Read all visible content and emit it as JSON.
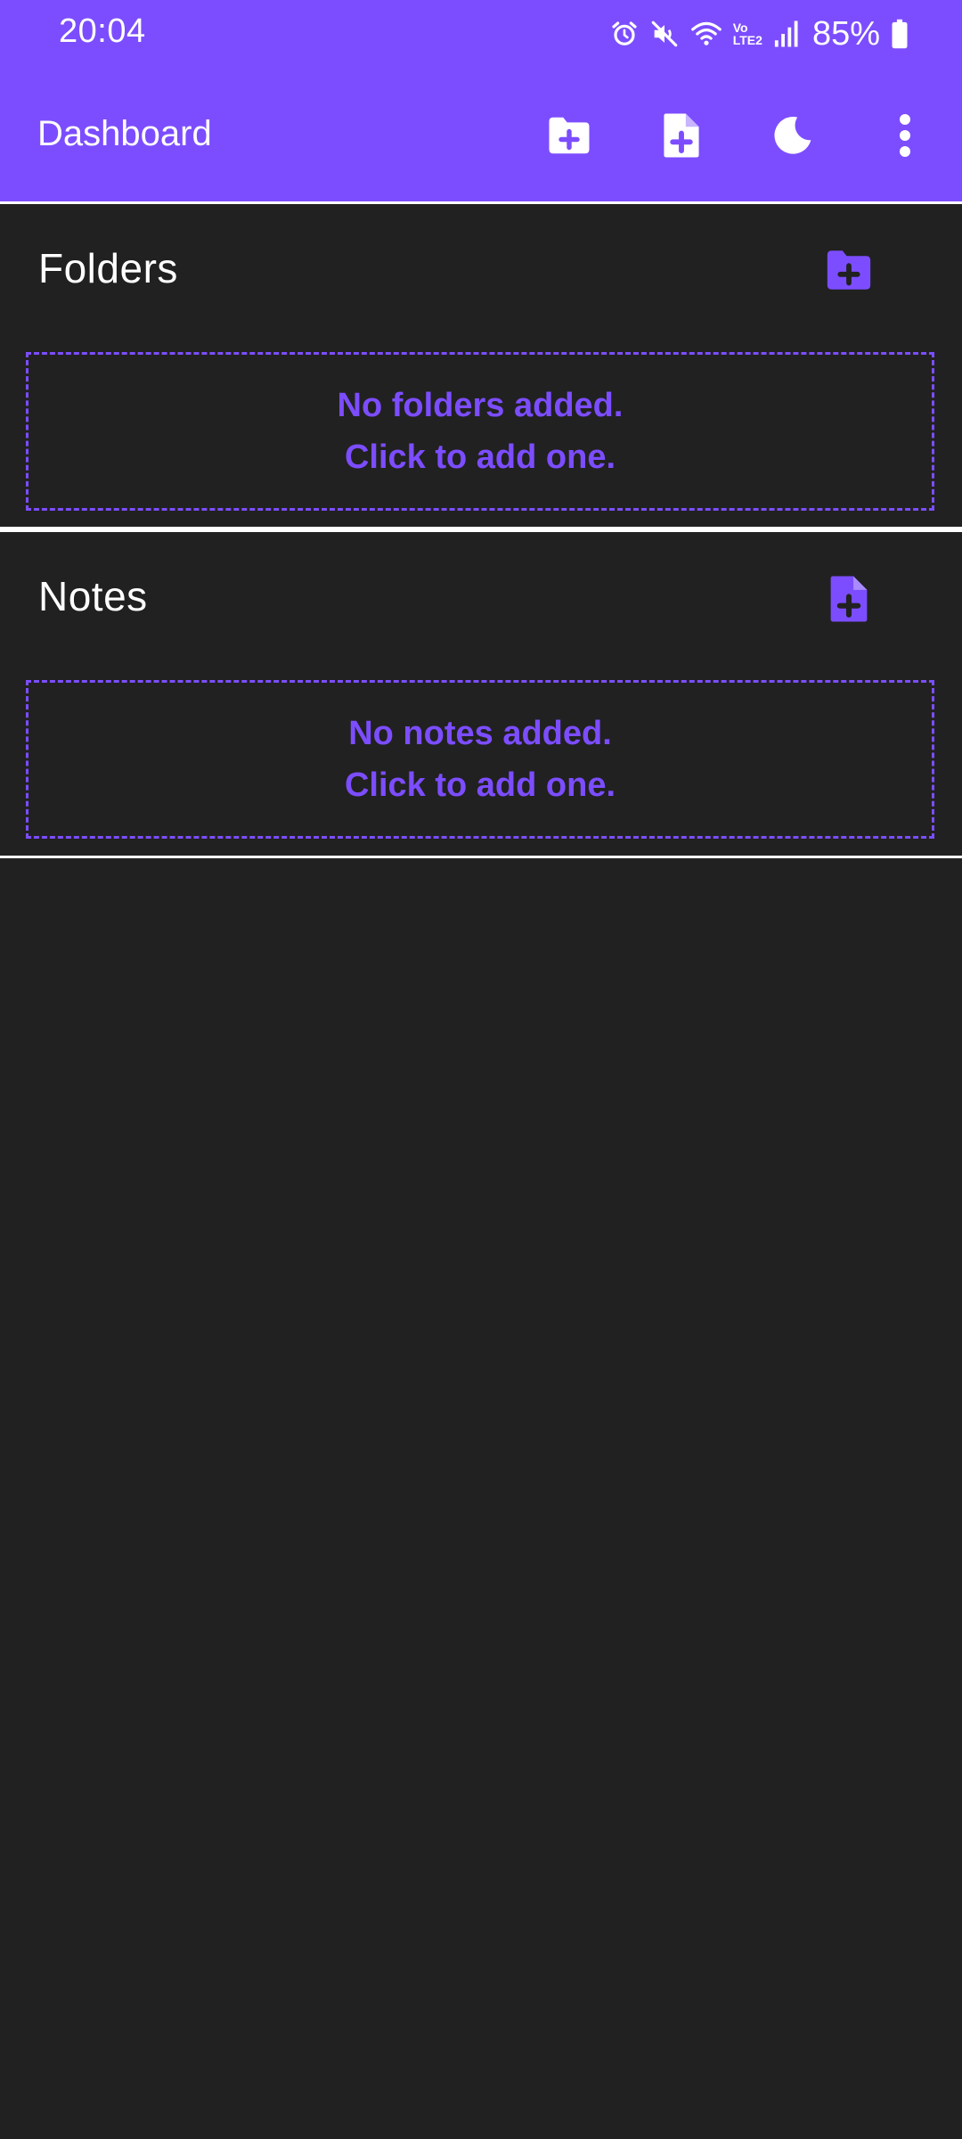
{
  "status_bar": {
    "time": "20:04",
    "battery": "85%",
    "network_label_top": "Vo",
    "network_label_bottom": "LTE2",
    "icons": [
      "alarm-icon",
      "mute-icon",
      "wifi-icon",
      "volte-icon",
      "signal-icon",
      "battery-icon"
    ]
  },
  "app_bar": {
    "title": "Dashboard",
    "actions": [
      "add-folder-icon",
      "add-note-icon",
      "dark-mode-moon-icon",
      "more-vert-icon"
    ]
  },
  "folders": {
    "title": "Folders",
    "empty_line1": "No folders added.",
    "empty_line2": "Click to add one."
  },
  "notes": {
    "title": "Notes",
    "empty_line1": "No notes added.",
    "empty_line2": "Click to add one."
  },
  "colors": {
    "accent": "#7c4dff",
    "background": "#212121",
    "text": "#ffffff"
  }
}
